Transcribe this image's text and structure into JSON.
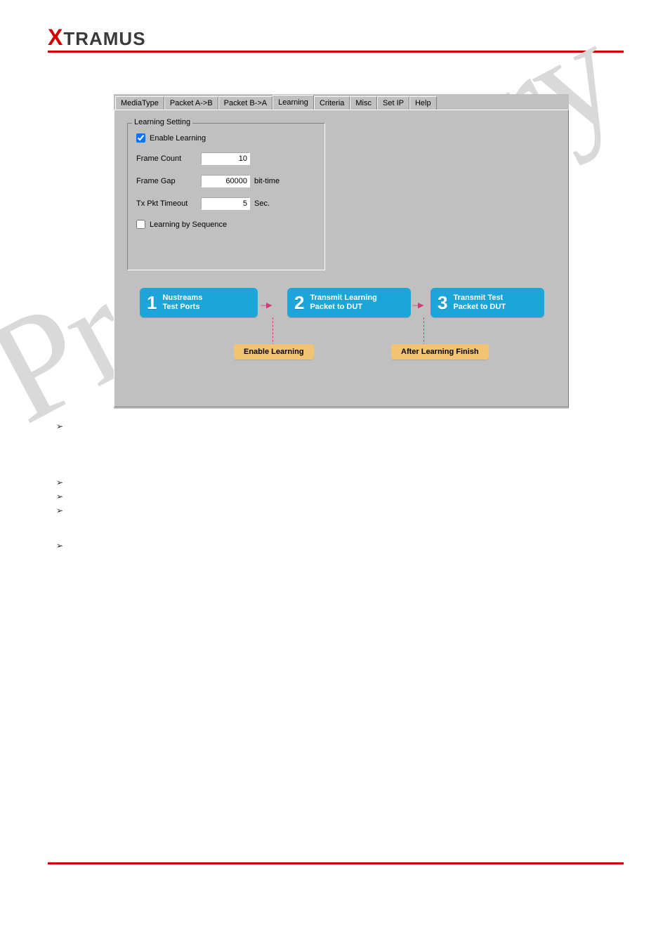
{
  "brand": {
    "x": "X",
    "rest": "TRAMUS"
  },
  "watermark": "Preliminary",
  "tabs": {
    "t0": "MediaType",
    "t1": "Packet A->B",
    "t2": "Packet B->A",
    "t3": "Learning",
    "t4": "Criteria",
    "t5": "Misc",
    "t6": "Set IP",
    "t7": "Help"
  },
  "group": {
    "title": "Learning Setting",
    "enable": "Enable Learning",
    "frame_count_label": "Frame Count",
    "frame_count_value": "10",
    "frame_gap_label": "Frame Gap",
    "frame_gap_value": "60000",
    "frame_gap_unit": "bit-time",
    "timeout_label": "Tx Pkt Timeout",
    "timeout_value": "5",
    "timeout_unit": "Sec.",
    "by_sequence": "Learning by Sequence"
  },
  "flow": {
    "s1": {
      "num": "1",
      "l1": "Nustreams",
      "l2": "Test Ports"
    },
    "s2": {
      "num": "2",
      "l1": "Transmit Learning",
      "l2": "Packet to DUT"
    },
    "s3": {
      "num": "3",
      "l1": "Transmit Test",
      "l2": "Packet to DUT"
    },
    "label1": "Enable Learning",
    "label2": "After Learning Finish"
  },
  "bullet_glyph": "➢"
}
